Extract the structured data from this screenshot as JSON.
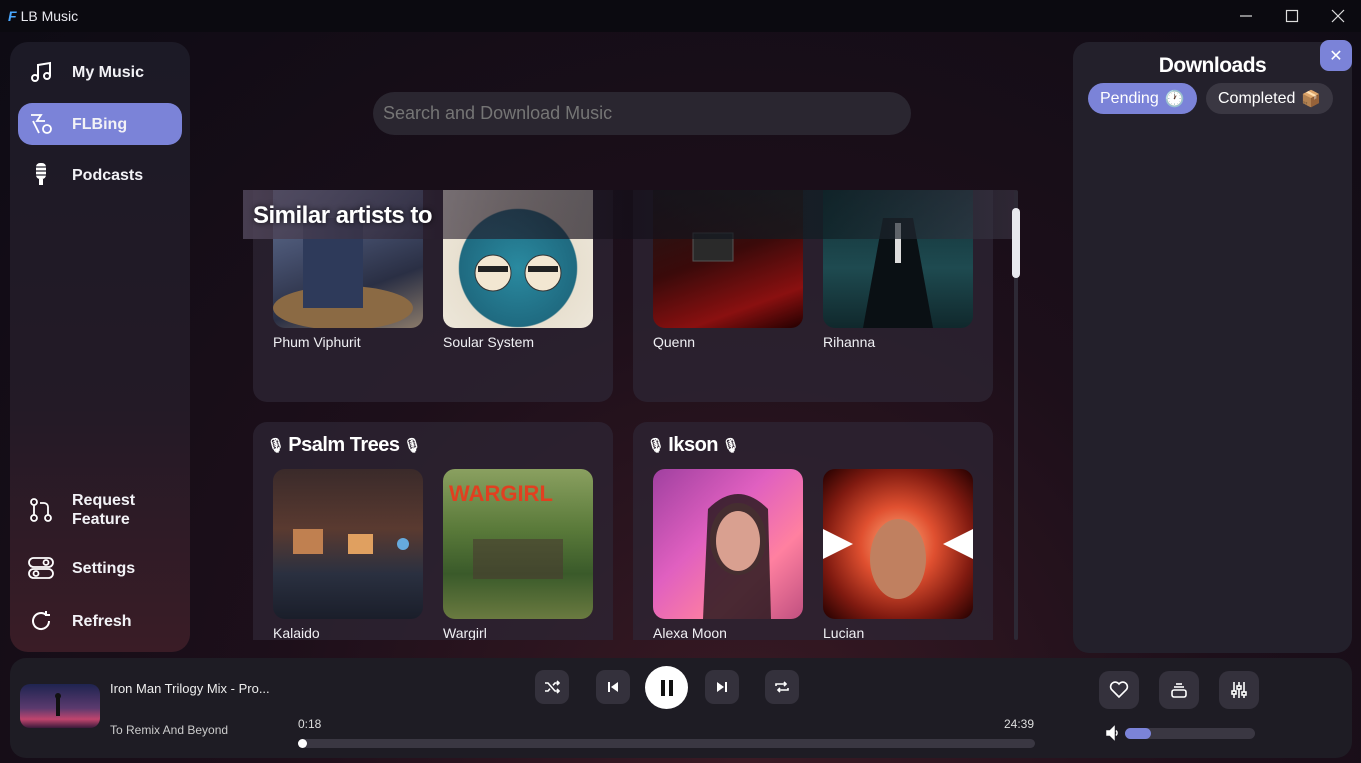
{
  "app": {
    "logo": "F",
    "title": "LB Music",
    "minimize": "—",
    "maximize": "☐",
    "close": "✕"
  },
  "sidebar": {
    "items": [
      {
        "label": "My Music",
        "icon": "music-note-icon"
      },
      {
        "label": "FLBing",
        "icon": "flbing-icon",
        "active": true
      },
      {
        "label": "Podcasts",
        "icon": "microphone-icon"
      }
    ],
    "bottom_items": [
      {
        "label": "Request\nFeature",
        "icon": "pull-request-icon"
      },
      {
        "label": "Settings",
        "icon": "toggle-settings-icon"
      },
      {
        "label": "Refresh",
        "icon": "refresh-icon"
      }
    ]
  },
  "search": {
    "placeholder": "Search and Download Music"
  },
  "main": {
    "section_title": "Similar artists to",
    "cards": [
      {
        "title": "",
        "artists": [
          "Phum Viphurit",
          "Soular System"
        ]
      },
      {
        "title": "",
        "artists": [
          "Quenn",
          "Rihanna"
        ]
      },
      {
        "title": "Psalm Trees",
        "artists": [
          "Kalaido",
          "Wargirl"
        ]
      },
      {
        "title": "Ikson",
        "artists": [
          "Alexa Moon",
          "Lucian"
        ]
      }
    ]
  },
  "downloads": {
    "title": "Downloads",
    "tabs": [
      {
        "label": "Pending",
        "emoji": "🕐",
        "active": true
      },
      {
        "label": "Completed",
        "emoji": "📦",
        "active": false
      }
    ],
    "close_icon": "✕"
  },
  "player": {
    "track_title": "Iron Man Trilogy Mix - Pro...",
    "track_artist": "To Remix And Beyond",
    "elapsed": "0:18",
    "duration": "24:39",
    "progress": 0.012,
    "volume": 0.2,
    "colors": {
      "accent": "#7b83d8"
    }
  }
}
